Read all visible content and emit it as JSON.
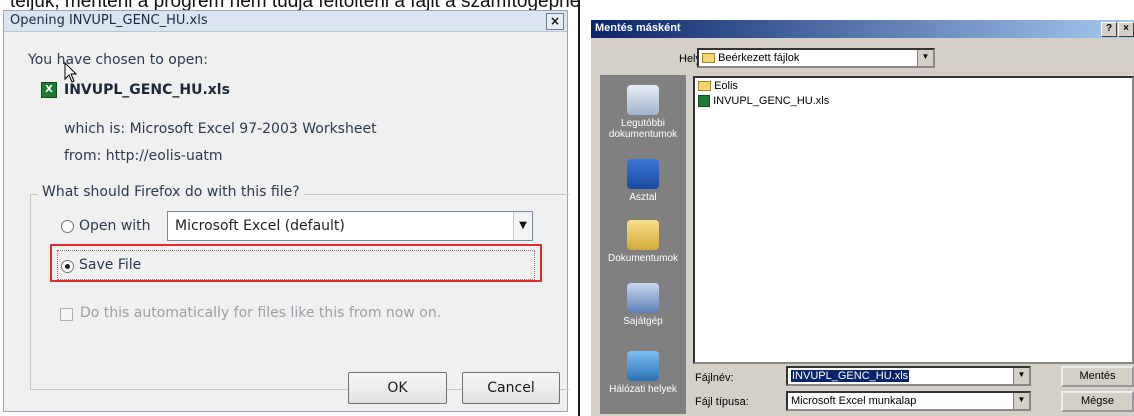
{
  "caption": "teljük, menteni a progrem nem tudja feltölteni a fájlt a számítógéphe",
  "firefox": {
    "title": "Opening INVUPL_GENC_HU.xls",
    "close_symbol": "×",
    "chosen_text": "You have chosen to open:",
    "filename": "INVUPL_GENC_HU.xls",
    "which_is": "which is: Microsoft Excel 97-2003 Worksheet",
    "from": "from: http://eolis-uatm",
    "question": "What should Firefox do with this file?",
    "open_with_label": "Open with",
    "open_with_value": "Microsoft Excel (default)",
    "save_file_label": "Save File",
    "auto_label": "Do this automatically for files like this from now on.",
    "ok_label": "OK",
    "cancel_label": "Cancel",
    "selected_option": "save-file",
    "highlight_color": "#e3292b"
  },
  "saveas": {
    "title": "Mentés másként",
    "help_symbol": "?",
    "close_symbol": "×",
    "location_label": "Hely:",
    "location_value": "Beérkezett fájlok",
    "toolbar_icons": [
      "back-icon",
      "up-folder-icon",
      "new-folder-icon",
      "view-menu-icon"
    ],
    "places": [
      {
        "label": "Legutóbbi dokumentumok",
        "icon": "recent-docs-icon"
      },
      {
        "label": "Asztal",
        "icon": "desktop-icon"
      },
      {
        "label": "Dokumentumok",
        "icon": "my-documents-icon"
      },
      {
        "label": "Sajátgép",
        "icon": "my-computer-icon"
      },
      {
        "label": "Hálózati helyek",
        "icon": "network-places-icon"
      }
    ],
    "files": [
      {
        "name": "Eolis",
        "type": "folder"
      },
      {
        "name": "INVUPL_GENC_HU.xls",
        "type": "xls"
      }
    ],
    "filename_label": "Fájlnév:",
    "filename_value": "INVUPL_GENC_HU.xls",
    "filetype_label": "Fájl típusa:",
    "filetype_value": "Microsoft Excel munkalap",
    "save_label": "Mentés",
    "cancel_label": "Mégse"
  }
}
